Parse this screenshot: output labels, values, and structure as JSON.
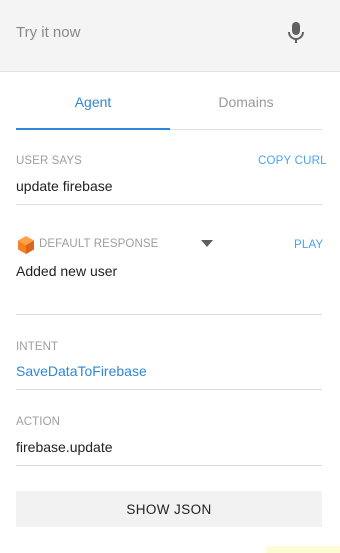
{
  "try_bar": {
    "placeholder": "Try it now",
    "mic_icon": "microphone-icon"
  },
  "tabs": [
    {
      "label": "Agent",
      "active": true
    },
    {
      "label": "Domains",
      "active": false
    }
  ],
  "user_says": {
    "label": "USER SAYS",
    "action_label": "COPY CURL",
    "value": "update firebase"
  },
  "response": {
    "icon": "cube-icon",
    "label": "DEFAULT RESPONSE",
    "dropdown_icon": "caret-down-icon",
    "action_label": "PLAY",
    "value": "Added new user"
  },
  "intent": {
    "label": "INTENT",
    "value": "SaveDataToFirebase"
  },
  "action": {
    "label": "ACTION",
    "value": "firebase.update"
  },
  "show_json_label": "SHOW JSON",
  "colors": {
    "accent": "#2e87d9",
    "link": "#49a4ef",
    "cube": "#f58220",
    "bar_bg": "#f4f4f4"
  }
}
